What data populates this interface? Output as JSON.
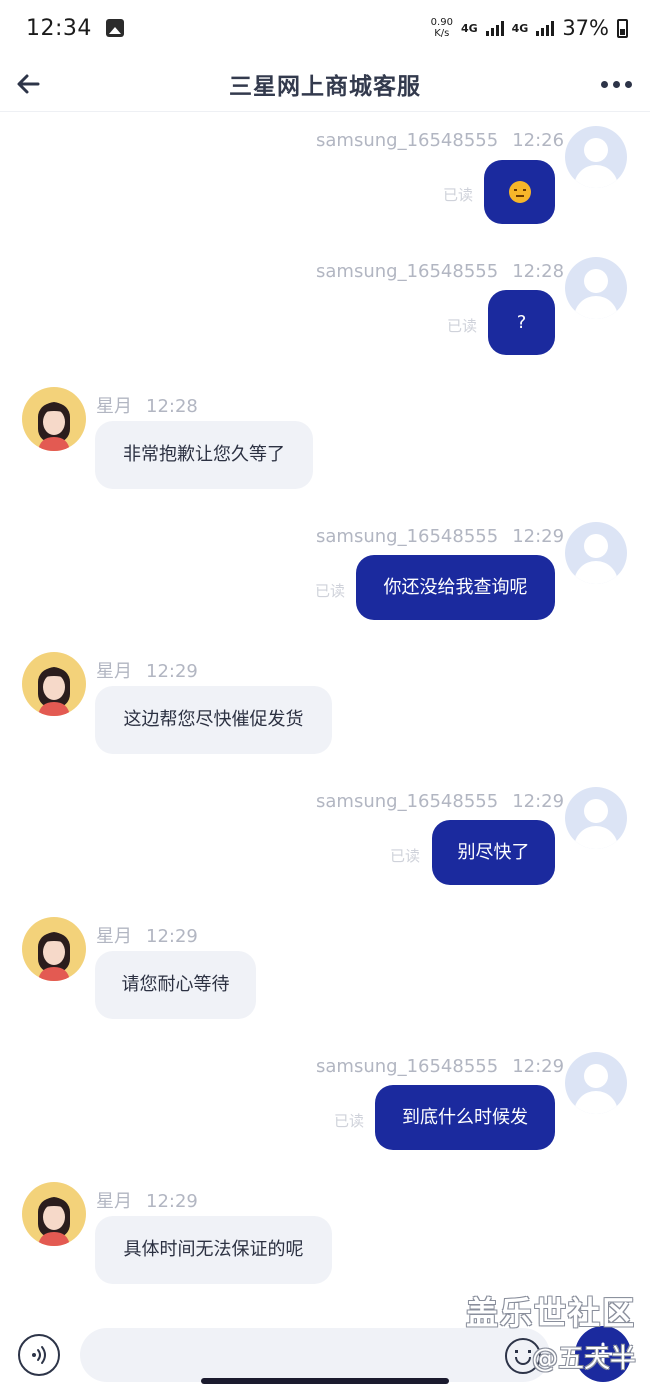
{
  "status_bar": {
    "time": "12:34",
    "net_speed_value": "0.90",
    "net_speed_unit": "K/s",
    "signal1": "4G",
    "signal2": "4G",
    "battery": "37%",
    "icons": [
      "gallery-icon",
      "signal-icon",
      "battery-icon"
    ]
  },
  "header": {
    "title": "三星网上商城客服",
    "back_icon": "arrow-left-icon",
    "more_icon": "more-dots-icon"
  },
  "messages": [
    {
      "sender": "user",
      "name": "samsung_16548555",
      "time": "12:26",
      "text": "",
      "emoji": "unamused-face",
      "read": "已读"
    },
    {
      "sender": "user",
      "name": "samsung_16548555",
      "time": "12:28",
      "text": "?",
      "read": "已读"
    },
    {
      "sender": "agent",
      "name": "星月",
      "time": "12:28",
      "text": "非常抱歉让您久等了"
    },
    {
      "sender": "user",
      "name": "samsung_16548555",
      "time": "12:29",
      "text": "你还没给我查询呢",
      "read": "已读"
    },
    {
      "sender": "agent",
      "name": "星月",
      "time": "12:29",
      "text": "这边帮您尽快催促发货"
    },
    {
      "sender": "user",
      "name": "samsung_16548555",
      "time": "12:29",
      "text": "别尽快了",
      "read": "已读"
    },
    {
      "sender": "agent",
      "name": "星月",
      "time": "12:29",
      "text": "请您耐心等待"
    },
    {
      "sender": "user",
      "name": "samsung_16548555",
      "time": "12:29",
      "text": "到底什么时候发",
      "read": "已读"
    },
    {
      "sender": "agent",
      "name": "星月",
      "time": "12:29",
      "text": "具体时间无法保证的呢"
    }
  ],
  "input_bar": {
    "placeholder": "",
    "icons": [
      "voice-icon",
      "emoji-icon",
      "plus-icon"
    ],
    "accent": "#1b2a9e"
  },
  "watermark": {
    "line1": "盖乐世社区",
    "line2": "@五天半"
  },
  "colors": {
    "user_bubble": "#1b2a9e",
    "agent_bubble": "#f0f2f7",
    "meta_text": "#b2b6c2"
  }
}
